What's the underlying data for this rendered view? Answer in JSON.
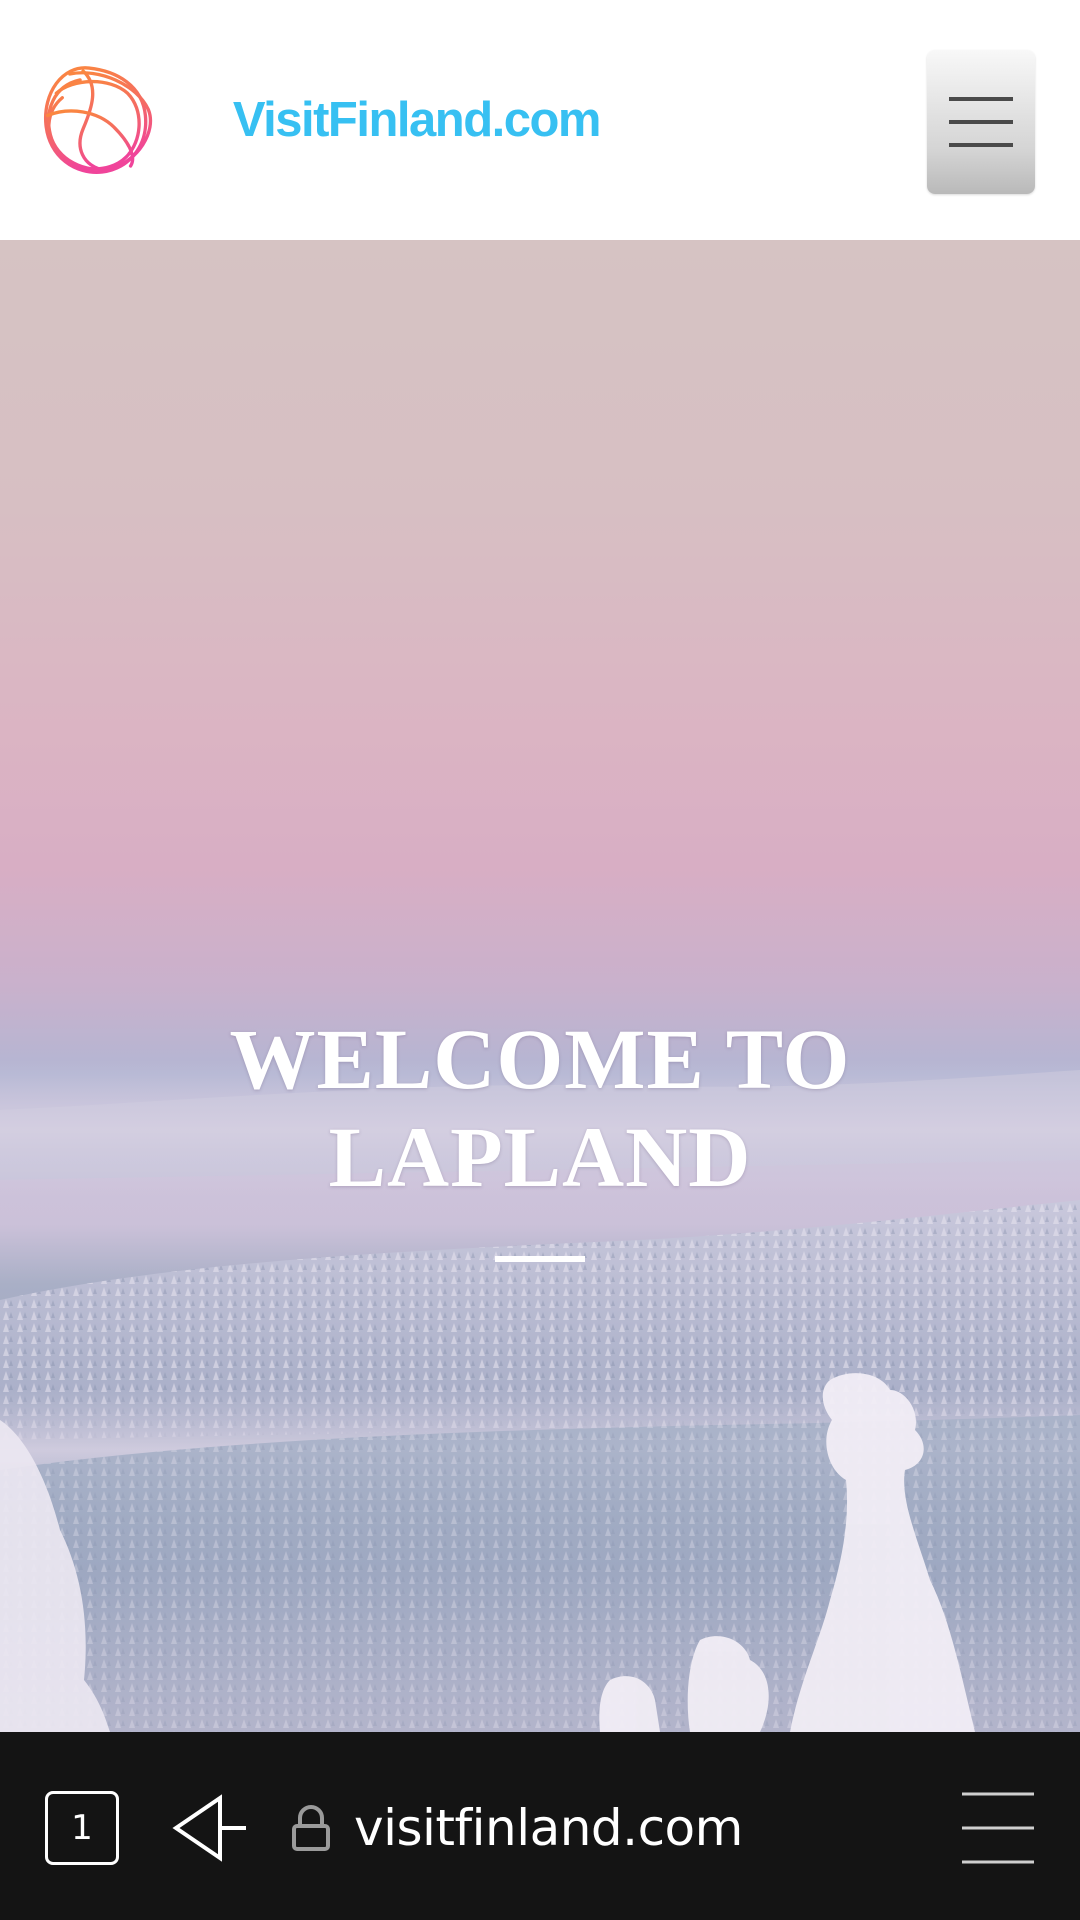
{
  "header": {
    "logo_text": "VisitFinland.com",
    "logo_icon": "visitfinland-logo-icon",
    "menu_icon": "hamburger-icon"
  },
  "hero": {
    "title": "WELCOME TO LAPLAND"
  },
  "browser": {
    "tab_count": "1",
    "url": "visitfinland.com",
    "back_icon": "back-arrow-icon",
    "lock_icon": "lock-icon",
    "menu_icon": "browser-menu-icon"
  },
  "colors": {
    "brand_text": "#37c0f2",
    "logo_gradient_start": "#fb8a3c",
    "logo_gradient_end": "#f0449a",
    "hero_title": "#ffffff",
    "browser_bar": "#141414"
  }
}
